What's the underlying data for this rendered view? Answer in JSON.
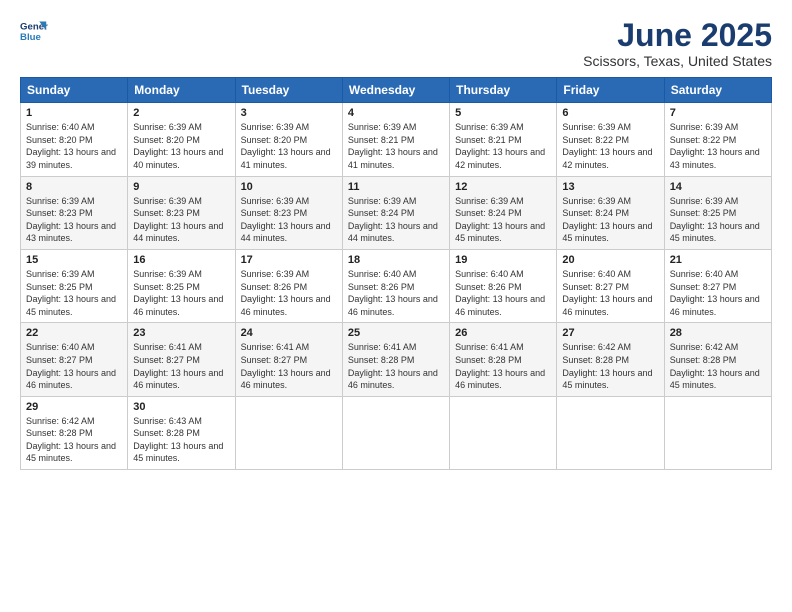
{
  "header": {
    "logo_line1": "General",
    "logo_line2": "Blue",
    "title": "June 2025",
    "subtitle": "Scissors, Texas, United States"
  },
  "weekdays": [
    "Sunday",
    "Monday",
    "Tuesday",
    "Wednesday",
    "Thursday",
    "Friday",
    "Saturday"
  ],
  "weeks": [
    [
      {
        "day": "1",
        "sunrise": "6:40 AM",
        "sunset": "8:20 PM",
        "daylight": "13 hours and 39 minutes."
      },
      {
        "day": "2",
        "sunrise": "6:39 AM",
        "sunset": "8:20 PM",
        "daylight": "13 hours and 40 minutes."
      },
      {
        "day": "3",
        "sunrise": "6:39 AM",
        "sunset": "8:20 PM",
        "daylight": "13 hours and 41 minutes."
      },
      {
        "day": "4",
        "sunrise": "6:39 AM",
        "sunset": "8:21 PM",
        "daylight": "13 hours and 41 minutes."
      },
      {
        "day": "5",
        "sunrise": "6:39 AM",
        "sunset": "8:21 PM",
        "daylight": "13 hours and 42 minutes."
      },
      {
        "day": "6",
        "sunrise": "6:39 AM",
        "sunset": "8:22 PM",
        "daylight": "13 hours and 42 minutes."
      },
      {
        "day": "7",
        "sunrise": "6:39 AM",
        "sunset": "8:22 PM",
        "daylight": "13 hours and 43 minutes."
      }
    ],
    [
      {
        "day": "8",
        "sunrise": "6:39 AM",
        "sunset": "8:23 PM",
        "daylight": "13 hours and 43 minutes."
      },
      {
        "day": "9",
        "sunrise": "6:39 AM",
        "sunset": "8:23 PM",
        "daylight": "13 hours and 44 minutes."
      },
      {
        "day": "10",
        "sunrise": "6:39 AM",
        "sunset": "8:23 PM",
        "daylight": "13 hours and 44 minutes."
      },
      {
        "day": "11",
        "sunrise": "6:39 AM",
        "sunset": "8:24 PM",
        "daylight": "13 hours and 44 minutes."
      },
      {
        "day": "12",
        "sunrise": "6:39 AM",
        "sunset": "8:24 PM",
        "daylight": "13 hours and 45 minutes."
      },
      {
        "day": "13",
        "sunrise": "6:39 AM",
        "sunset": "8:24 PM",
        "daylight": "13 hours and 45 minutes."
      },
      {
        "day": "14",
        "sunrise": "6:39 AM",
        "sunset": "8:25 PM",
        "daylight": "13 hours and 45 minutes."
      }
    ],
    [
      {
        "day": "15",
        "sunrise": "6:39 AM",
        "sunset": "8:25 PM",
        "daylight": "13 hours and 45 minutes."
      },
      {
        "day": "16",
        "sunrise": "6:39 AM",
        "sunset": "8:25 PM",
        "daylight": "13 hours and 46 minutes."
      },
      {
        "day": "17",
        "sunrise": "6:39 AM",
        "sunset": "8:26 PM",
        "daylight": "13 hours and 46 minutes."
      },
      {
        "day": "18",
        "sunrise": "6:40 AM",
        "sunset": "8:26 PM",
        "daylight": "13 hours and 46 minutes."
      },
      {
        "day": "19",
        "sunrise": "6:40 AM",
        "sunset": "8:26 PM",
        "daylight": "13 hours and 46 minutes."
      },
      {
        "day": "20",
        "sunrise": "6:40 AM",
        "sunset": "8:27 PM",
        "daylight": "13 hours and 46 minutes."
      },
      {
        "day": "21",
        "sunrise": "6:40 AM",
        "sunset": "8:27 PM",
        "daylight": "13 hours and 46 minutes."
      }
    ],
    [
      {
        "day": "22",
        "sunrise": "6:40 AM",
        "sunset": "8:27 PM",
        "daylight": "13 hours and 46 minutes."
      },
      {
        "day": "23",
        "sunrise": "6:41 AM",
        "sunset": "8:27 PM",
        "daylight": "13 hours and 46 minutes."
      },
      {
        "day": "24",
        "sunrise": "6:41 AM",
        "sunset": "8:27 PM",
        "daylight": "13 hours and 46 minutes."
      },
      {
        "day": "25",
        "sunrise": "6:41 AM",
        "sunset": "8:28 PM",
        "daylight": "13 hours and 46 minutes."
      },
      {
        "day": "26",
        "sunrise": "6:41 AM",
        "sunset": "8:28 PM",
        "daylight": "13 hours and 46 minutes."
      },
      {
        "day": "27",
        "sunrise": "6:42 AM",
        "sunset": "8:28 PM",
        "daylight": "13 hours and 45 minutes."
      },
      {
        "day": "28",
        "sunrise": "6:42 AM",
        "sunset": "8:28 PM",
        "daylight": "13 hours and 45 minutes."
      }
    ],
    [
      {
        "day": "29",
        "sunrise": "6:42 AM",
        "sunset": "8:28 PM",
        "daylight": "13 hours and 45 minutes."
      },
      {
        "day": "30",
        "sunrise": "6:43 AM",
        "sunset": "8:28 PM",
        "daylight": "13 hours and 45 minutes."
      },
      null,
      null,
      null,
      null,
      null
    ]
  ]
}
